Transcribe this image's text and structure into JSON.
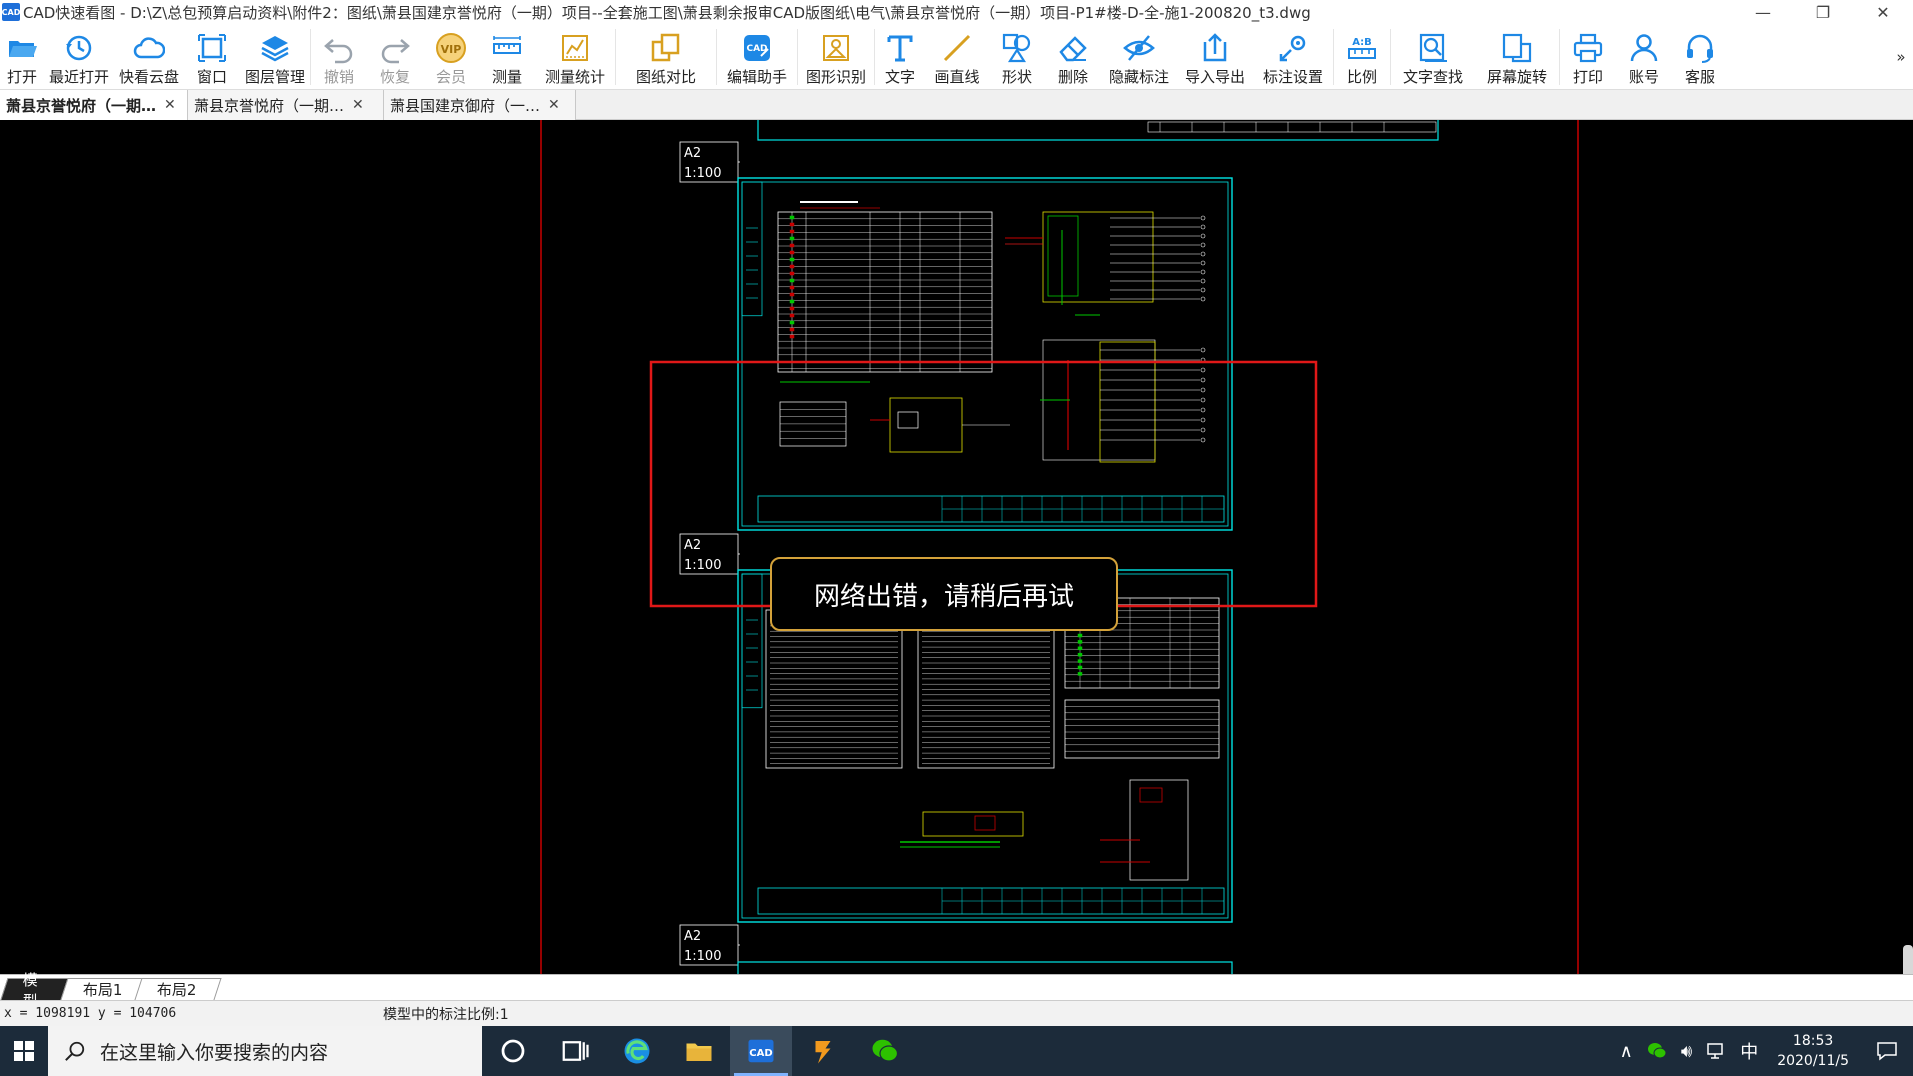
{
  "window": {
    "title": "CAD快速看图 - D:\\Z\\总包预算启动资料\\附件2：图纸\\萧县国建京誉悦府（一期）项目--全套施工图\\萧县剩余报审CAD版图纸\\电气\\萧县京誉悦府（一期）项目-P1#楼-D-全-施1-200820_t3.dwg",
    "app_icon_text": "CAD"
  },
  "toolbar": {
    "items": [
      {
        "label": "打开",
        "icon": "folder-open-icon",
        "enabled": true
      },
      {
        "label": "最近打开",
        "icon": "recent-icon",
        "enabled": true
      },
      {
        "label": "快看云盘",
        "icon": "cloud-icon",
        "enabled": true
      },
      {
        "label": "窗口",
        "icon": "window-icon",
        "enabled": true
      },
      {
        "label": "图层管理",
        "icon": "layers-icon",
        "enabled": true
      },
      {
        "label": "撤销",
        "icon": "undo-icon",
        "enabled": false
      },
      {
        "label": "恢复",
        "icon": "redo-icon",
        "enabled": false
      },
      {
        "label": "会员",
        "icon": "vip-icon",
        "enabled": false,
        "icon_text": "VIP"
      },
      {
        "label": "测量",
        "icon": "measure-icon",
        "enabled": true
      },
      {
        "label": "测量统计",
        "icon": "measure-stats-icon",
        "enabled": true
      },
      {
        "label": "图纸对比",
        "icon": "compare-icon",
        "enabled": true
      },
      {
        "label": "编辑助手",
        "icon": "edit-assistant-icon",
        "enabled": true,
        "icon_text": "CAD"
      },
      {
        "label": "图形识别",
        "icon": "shape-recognize-icon",
        "enabled": true
      },
      {
        "label": "文字",
        "icon": "text-icon",
        "enabled": true
      },
      {
        "label": "画直线",
        "icon": "line-icon",
        "enabled": true
      },
      {
        "label": "形状",
        "icon": "shape-icon",
        "enabled": true
      },
      {
        "label": "删除",
        "icon": "eraser-icon",
        "enabled": true
      },
      {
        "label": "隐藏标注",
        "icon": "hide-annotation-icon",
        "enabled": true
      },
      {
        "label": "导入导出",
        "icon": "import-export-icon",
        "enabled": true
      },
      {
        "label": "标注设置",
        "icon": "annotation-settings-icon",
        "enabled": true
      },
      {
        "label": "比例",
        "icon": "scale-icon",
        "enabled": true,
        "icon_text": "A:B"
      },
      {
        "label": "文字查找",
        "icon": "text-search-icon",
        "enabled": true
      },
      {
        "label": "屏幕旋转",
        "icon": "rotate-screen-icon",
        "enabled": true
      },
      {
        "label": "打印",
        "icon": "print-icon",
        "enabled": true
      },
      {
        "label": "账号",
        "icon": "account-icon",
        "enabled": true
      },
      {
        "label": "客服",
        "icon": "headset-icon",
        "enabled": true
      }
    ],
    "more": "»"
  },
  "tabs": [
    {
      "label": "萧县京誉悦府（一期…",
      "active": true
    },
    {
      "label": "萧县京誉悦府（一期…",
      "active": false
    },
    {
      "label": "萧县国建京御府（一…",
      "active": false
    }
  ],
  "drawing": {
    "sheet_labels": [
      {
        "size": "A2",
        "scale": "1:100"
      },
      {
        "size": "A2",
        "scale": "1:100"
      },
      {
        "size": "A2",
        "scale": "1:100"
      }
    ],
    "colors": {
      "frame": "#00e5e5",
      "guide": "#c80000",
      "highlight": "#e01818",
      "yellow": "#e0e000",
      "green": "#00c800",
      "white": "#ffffff"
    }
  },
  "toast": {
    "message": "网络出错，请稍后再试"
  },
  "layout_tabs": [
    {
      "label": "模型",
      "active": true
    },
    {
      "label": "布局1",
      "active": false
    },
    {
      "label": "布局2",
      "active": false
    }
  ],
  "status": {
    "coords": "x = 1098191  y = 104706",
    "scale_text": "模型中的标注比例:1"
  },
  "taskbar": {
    "search_placeholder": "在这里输入你要搜索的内容",
    "apps": [
      {
        "name": "cortana-icon"
      },
      {
        "name": "task-view-icon"
      },
      {
        "name": "edge-icon"
      },
      {
        "name": "file-explorer-icon"
      },
      {
        "name": "cad-app-icon",
        "active": true,
        "icon_text": "CAD"
      },
      {
        "name": "app-orange-icon"
      },
      {
        "name": "wechat-icon"
      }
    ],
    "ime": "中",
    "time": "18:53",
    "date": "2020/11/5"
  }
}
